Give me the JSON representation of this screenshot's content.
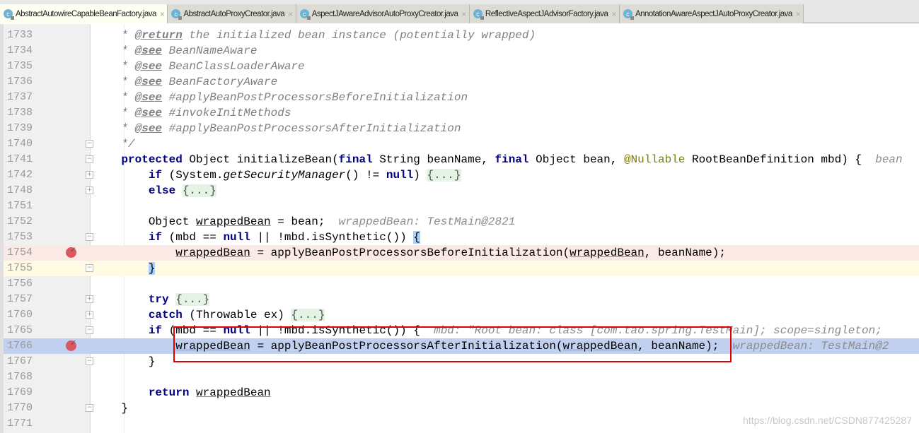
{
  "tabs": [
    {
      "label": "AbstractAutowireCapableBeanFactory.java",
      "active": true,
      "icon": "class-icon"
    },
    {
      "label": "AbstractAutoProxyCreator.java",
      "active": false,
      "icon": "class-icon"
    },
    {
      "label": "AspectJAwareAdvisorAutoProxyCreator.java",
      "active": false,
      "icon": "class-icon"
    },
    {
      "label": "ReflectiveAspectJAdvisorFactory.java",
      "active": false,
      "icon": "class-icon"
    },
    {
      "label": "AnnotationAwareAspectJAutoProxyCreator.java",
      "active": false,
      "icon": "class-icon"
    }
  ],
  "colors": {
    "breakpoint": "#db5860",
    "execution_line": "#c1d0ef",
    "breakpoint_line": "#fbe9e6",
    "caret_line": "#fffae3",
    "highlight_box": "#e00000",
    "keyword": "#000080"
  },
  "lines": [
    {
      "n": "1733",
      "t": [
        [
          "cm",
          "    * "
        ],
        [
          "tag",
          "@return"
        ],
        [
          "cm",
          " the initialized bean instance (potentially wrapped)"
        ]
      ]
    },
    {
      "n": "1734",
      "t": [
        [
          "cm",
          "    * "
        ],
        [
          "tag",
          "@see"
        ],
        [
          "cm",
          " BeanNameAware"
        ]
      ]
    },
    {
      "n": "1735",
      "t": [
        [
          "cm",
          "    * "
        ],
        [
          "tag",
          "@see"
        ],
        [
          "cm",
          " BeanClassLoaderAware"
        ]
      ]
    },
    {
      "n": "1736",
      "t": [
        [
          "cm",
          "    * "
        ],
        [
          "tag",
          "@see"
        ],
        [
          "cm",
          " BeanFactoryAware"
        ]
      ]
    },
    {
      "n": "1737",
      "t": [
        [
          "cm",
          "    * "
        ],
        [
          "tag",
          "@see"
        ],
        [
          "cm",
          " #applyBeanPostProcessorsBeforeInitialization"
        ]
      ]
    },
    {
      "n": "1738",
      "t": [
        [
          "cm",
          "    * "
        ],
        [
          "tag",
          "@see"
        ],
        [
          "cm",
          " #invokeInitMethods"
        ]
      ]
    },
    {
      "n": "1739",
      "t": [
        [
          "cm",
          "    * "
        ],
        [
          "tag",
          "@see"
        ],
        [
          "cm",
          " #applyBeanPostProcessorsAfterInitialization"
        ]
      ]
    },
    {
      "n": "1740",
      "t": [
        [
          "cm",
          "    */"
        ]
      ],
      "fold": "-"
    },
    {
      "n": "1741",
      "t": [
        [
          "",
          "    "
        ],
        [
          "kw",
          "protected"
        ],
        [
          "",
          " Object initializeBean("
        ],
        [
          "kw",
          "final"
        ],
        [
          "",
          " String beanName, "
        ],
        [
          "kw",
          "final"
        ],
        [
          "",
          " Object bean, "
        ],
        [
          "ann",
          "@Nullable"
        ],
        [
          "",
          " RootBeanDefinition mbd) {  "
        ],
        [
          "hint",
          "bean"
        ]
      ],
      "fold": "-"
    },
    {
      "n": "1742",
      "t": [
        [
          "",
          "        "
        ],
        [
          "kw",
          "if"
        ],
        [
          "",
          " (System."
        ],
        [
          "it",
          "getSecurityManager"
        ],
        [
          "",
          "() != "
        ],
        [
          "kw",
          "null"
        ],
        [
          "",
          ") "
        ],
        [
          "fold",
          "{...}"
        ]
      ],
      "fold": "+"
    },
    {
      "n": "1748",
      "t": [
        [
          "",
          "        "
        ],
        [
          "kw",
          "else"
        ],
        [
          "",
          " "
        ],
        [
          "fold",
          "{...}"
        ]
      ],
      "fold": "+"
    },
    {
      "n": "1751",
      "t": []
    },
    {
      "n": "1752",
      "t": [
        [
          "",
          "        Object "
        ],
        [
          "ul",
          "wrappedBean"
        ],
        [
          "",
          " = bean;  "
        ],
        [
          "hint",
          "wrappedBean: TestMain@2821"
        ]
      ]
    },
    {
      "n": "1753",
      "t": [
        [
          "",
          "        "
        ],
        [
          "kw",
          "if"
        ],
        [
          "",
          " (mbd == "
        ],
        [
          "kw",
          "null"
        ],
        [
          "",
          " || !mbd.isSynthetic()) "
        ],
        [
          "cur",
          "{"
        ]
      ],
      "fold": "-"
    },
    {
      "n": "1754",
      "t": [
        [
          "",
          "            "
        ],
        [
          "ul",
          "wrappedBean"
        ],
        [
          "",
          " = applyBeanPostProcessorsBeforeInitialization("
        ],
        [
          "ul",
          "wrappedBean"
        ],
        [
          "",
          ", beanName);"
        ]
      ],
      "bp": true,
      "bg": "breakpoint_line"
    },
    {
      "n": "1755",
      "t": [
        [
          "",
          "        "
        ],
        [
          "cur",
          "}"
        ]
      ],
      "fold": "-",
      "bg": "caret_line"
    },
    {
      "n": "1756",
      "t": []
    },
    {
      "n": "1757",
      "t": [
        [
          "",
          "        "
        ],
        [
          "kw",
          "try"
        ],
        [
          "",
          " "
        ],
        [
          "fold",
          "{...}"
        ]
      ],
      "fold": "+"
    },
    {
      "n": "1760",
      "t": [
        [
          "",
          "        "
        ],
        [
          "kw",
          "catch"
        ],
        [
          "",
          " (Throwable ex) "
        ],
        [
          "fold",
          "{...}"
        ]
      ],
      "fold": "+"
    },
    {
      "n": "1765",
      "t": [
        [
          "",
          "        "
        ],
        [
          "kw",
          "if"
        ],
        [
          "",
          " (mbd == "
        ],
        [
          "kw",
          "null"
        ],
        [
          "",
          " || !mbd.isSynthetic()) {  "
        ],
        [
          "hint",
          "mbd: \"Root bean: class [com.tao.spring.TestMain]; scope=singleton;"
        ]
      ],
      "fold": "-"
    },
    {
      "n": "1766",
      "t": [
        [
          "",
          "            "
        ],
        [
          "ul",
          "wrappedBean"
        ],
        [
          "",
          " = applyBeanPostProcessorsAfterInitialization("
        ],
        [
          "ul",
          "wrappedBean"
        ],
        [
          "",
          ", beanName);  "
        ],
        [
          "hint",
          "wrappedBean: TestMain@2"
        ]
      ],
      "bp": true,
      "bg": "execution_line"
    },
    {
      "n": "1767",
      "t": [
        [
          "",
          "        }"
        ]
      ],
      "fold": "-"
    },
    {
      "n": "1768",
      "t": []
    },
    {
      "n": "1769",
      "t": [
        [
          "",
          "        "
        ],
        [
          "kw",
          "return"
        ],
        [
          "",
          " "
        ],
        [
          "ul",
          "wrappedBean"
        ],
        [
          ";"
        ]
      ]
    },
    {
      "n": "1770",
      "t": [
        [
          "",
          "    }"
        ]
      ],
      "fold": "-"
    },
    {
      "n": "1771",
      "t": []
    }
  ],
  "watermark": "https://blog.csdn.net/CSDN877425287"
}
